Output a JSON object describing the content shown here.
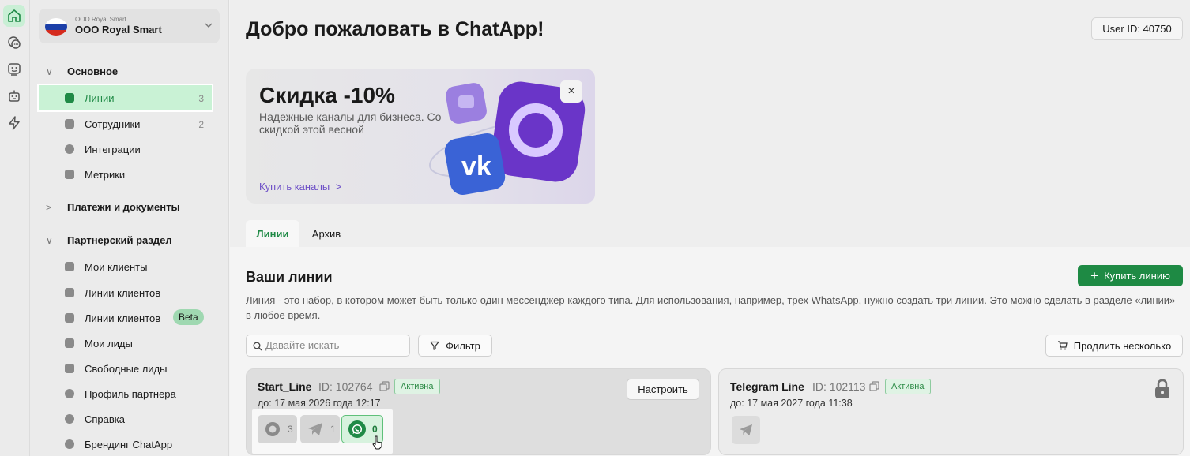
{
  "rail": {
    "items": [
      {
        "icon": "home-icon",
        "active": true
      },
      {
        "icon": "chat-icon",
        "active": false
      },
      {
        "icon": "bot-face-icon",
        "active": false
      },
      {
        "icon": "robot-icon",
        "active": false
      },
      {
        "icon": "lightning-icon",
        "active": false
      }
    ]
  },
  "org": {
    "subtitle": "ООО Royal Smart",
    "name": "ООО Royal Smart"
  },
  "sidebar": {
    "section_main": "Основное",
    "main_items": [
      {
        "label": "Линии",
        "count": "3",
        "active": true
      },
      {
        "label": "Сотрудники",
        "count": "2"
      },
      {
        "label": "Интеграции"
      },
      {
        "label": "Метрики"
      }
    ],
    "section_payments": "Платежи и документы",
    "section_partner": "Партнерский раздел",
    "partner_items": [
      {
        "label": "Мои клиенты"
      },
      {
        "label": "Линии клиентов"
      },
      {
        "label": "Линии клиентов",
        "badge": "Beta"
      },
      {
        "label": "Мои лиды"
      },
      {
        "label": "Свободные лиды"
      },
      {
        "label": "Профиль партнера"
      },
      {
        "label": "Справка"
      },
      {
        "label": "Брендинг ChatApp"
      }
    ]
  },
  "header": {
    "title": "Добро пожаловать в ChatApp!",
    "user_id": "User ID: 40750"
  },
  "promo": {
    "title": "Скидка -10%",
    "text": "Надежные каналы для бизнеса. Со скидкой этой весной",
    "link": "Купить каналы",
    "close": "×"
  },
  "tabs": [
    {
      "label": "Линии",
      "active": true
    },
    {
      "label": "Архив"
    }
  ],
  "lines": {
    "heading": "Ваши линии",
    "buy_label": "Купить линию",
    "description": "Линия - это набор, в котором может быть только один мессенджер каждого типа. Для использования, например, трех WhatsApp, нужно создать три линии. Это можно сделать в разделе «линии» в любое время.",
    "search_placeholder": "Давайте искать",
    "filter_label": "Фильтр",
    "renew_label": "Продлить несколько",
    "cards": [
      {
        "name": "Start_Line",
        "id": "ID: 102764",
        "status": "Активна",
        "until": "до: 17 мая 2026 года 12:17",
        "configure": "Настроить",
        "channels": [
          {
            "type": "max",
            "count": "3"
          },
          {
            "type": "telegram",
            "count": "1"
          },
          {
            "type": "whatsapp",
            "count": "0"
          }
        ]
      },
      {
        "name": "Telegram Line",
        "id": "ID: 102113",
        "status": "Активна",
        "until": "до: 17 мая 2027 года 11:38",
        "locked": true
      }
    ]
  },
  "colors": {
    "accent": "#1e8a44",
    "active_bg": "#c9f2d5",
    "promo_link": "#6d4fc7"
  }
}
